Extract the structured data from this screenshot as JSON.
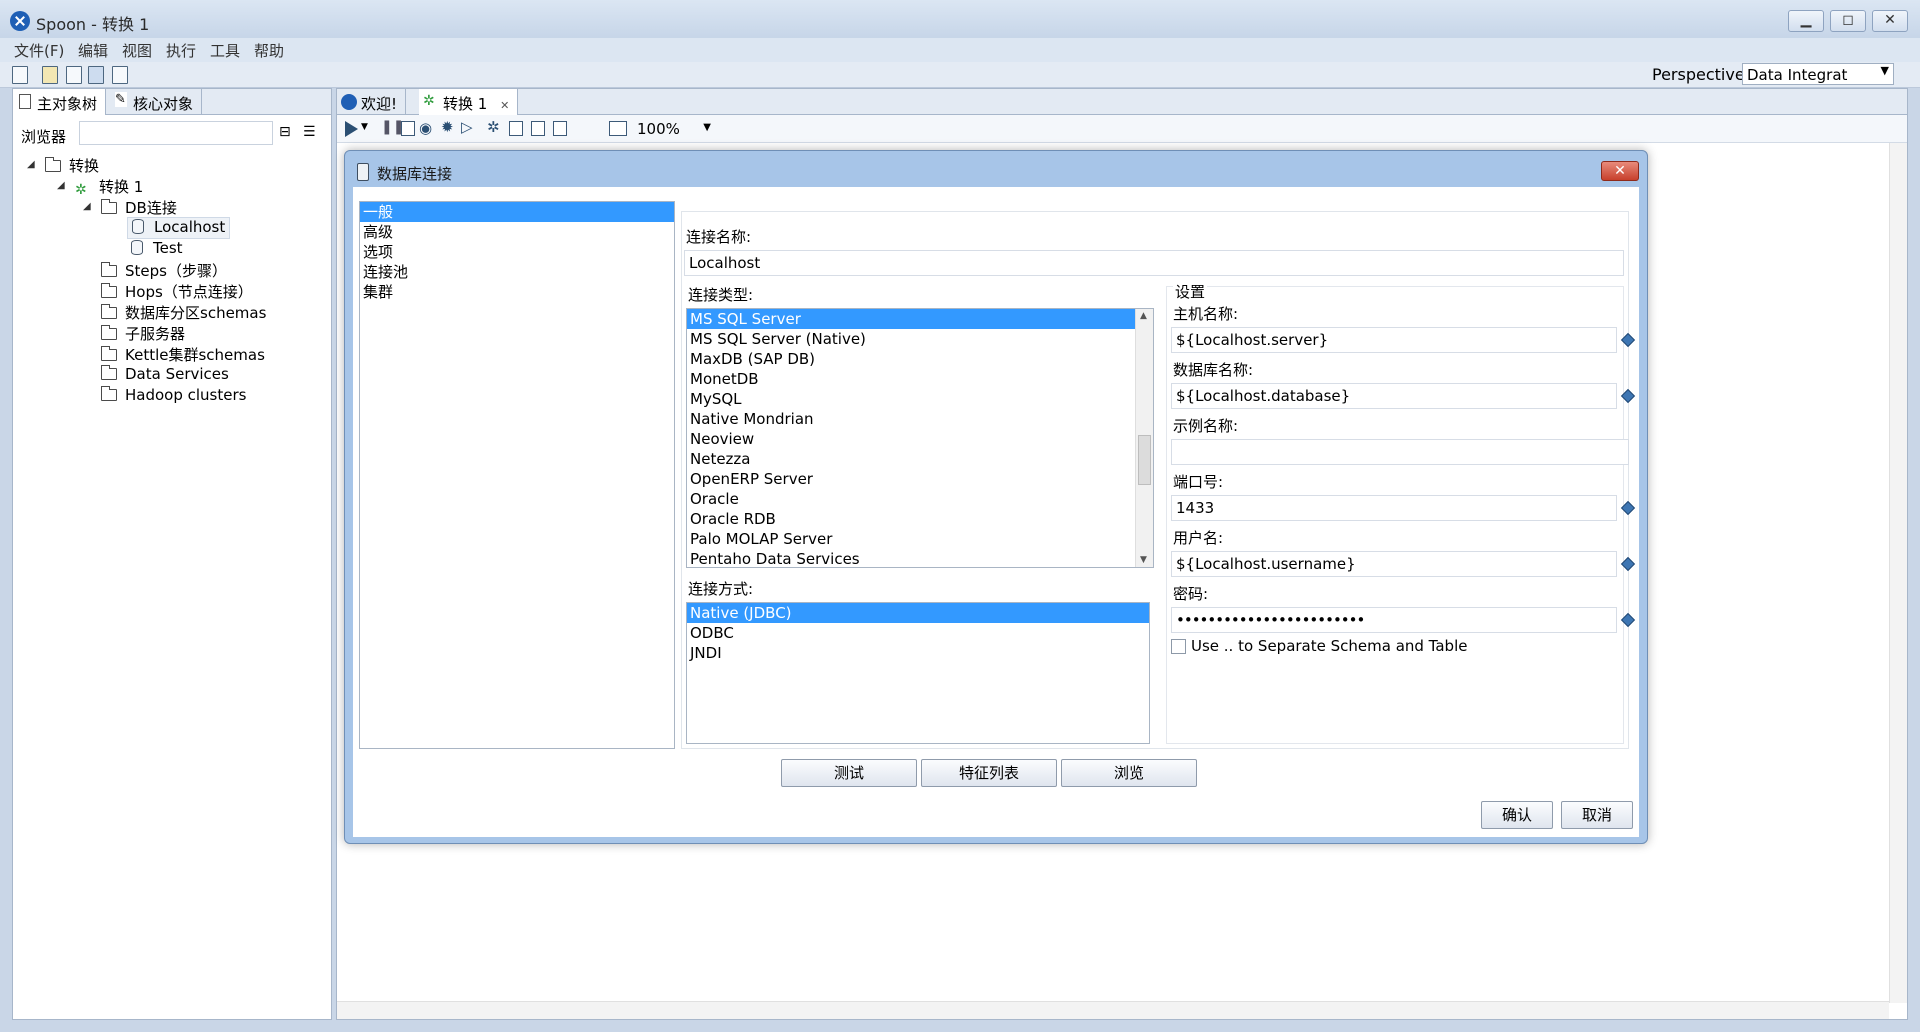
{
  "window": {
    "title": "Spoon - 转换 1"
  },
  "menu": [
    "文件(F)",
    "编辑",
    "视图",
    "执行",
    "工具",
    "帮助"
  ],
  "perspective": {
    "label": "Perspective:",
    "value": "Data Integrat"
  },
  "left_tabs": [
    "主对象树",
    "核心对象"
  ],
  "browser": {
    "label": "浏览器",
    "value": ""
  },
  "tree": {
    "root": "转换",
    "trans": "转换 1",
    "db_folder": "DB连接",
    "db_items": [
      "Localhost",
      "Test"
    ],
    "folders": [
      "Steps（步骤）",
      "Hops（节点连接）",
      "数据库分区schemas",
      "子服务器",
      "Kettle集群schemas",
      "Data Services",
      "Hadoop clusters"
    ]
  },
  "editor_tabs": [
    "欢迎!",
    "转换 1"
  ],
  "zoom": "100%",
  "dialog": {
    "title": "数据库连接",
    "categories": [
      "一般",
      "高级",
      "选项",
      "连接池",
      "集群"
    ],
    "conn_name_label": "连接名称:",
    "conn_name_value": "Localhost",
    "conn_type_label": "连接类型:",
    "conn_types": [
      "MS SQL Server",
      "MS SQL Server (Native)",
      "MaxDB (SAP DB)",
      "MonetDB",
      "MySQL",
      "Native Mondrian",
      "Neoview",
      "Netezza",
      "OpenERP Server",
      "Oracle",
      "Oracle RDB",
      "Palo MOLAP Server",
      "Pentaho Data Services"
    ],
    "access_label": "连接方式:",
    "access_types": [
      "Native (JDBC)",
      "ODBC",
      "JNDI"
    ],
    "settings": {
      "group_label": "设置",
      "host_label": "主机名称:",
      "host_value": "${Localhost.server}",
      "db_label": "数据库名称:",
      "db_value": "${Localhost.database}",
      "instance_label": "示例名称:",
      "instance_value": "",
      "port_label": "端口号:",
      "port_value": "1433",
      "user_label": "用户名:",
      "user_value": "${Localhost.username}",
      "password_label": "密码:",
      "password_value": "••••••••••••••••••••••••",
      "checkbox_label": "Use .. to Separate Schema and Table"
    },
    "buttons": {
      "test": "测试",
      "features": "特征列表",
      "explore": "浏览",
      "ok": "确认",
      "cancel": "取消"
    }
  }
}
